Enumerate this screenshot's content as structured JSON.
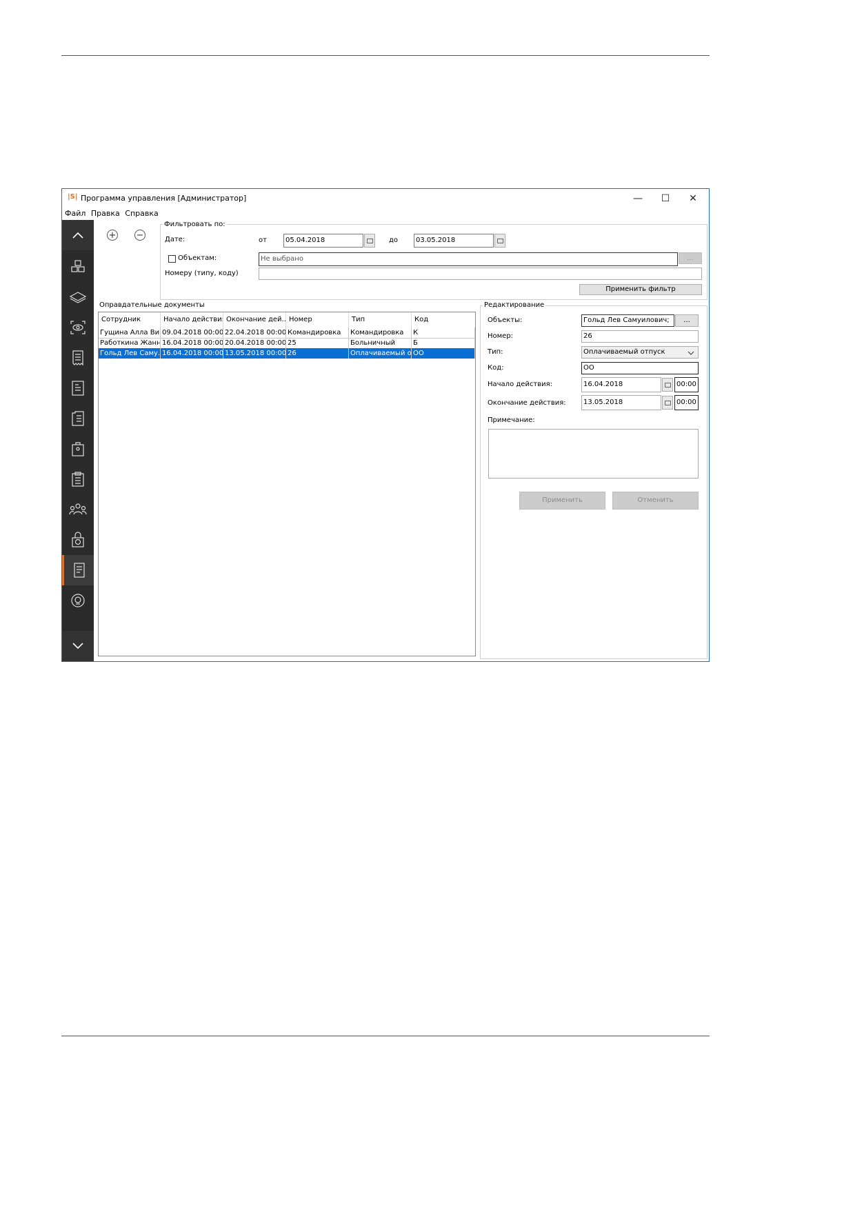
{
  "window": {
    "logo": "|S|",
    "title": "Программа управления [Администратор]",
    "minimize": "—",
    "maximize": "☐",
    "close": "✕"
  },
  "menu": [
    "Файл",
    "Правка",
    "Справка"
  ],
  "toolbar": {
    "add": "+",
    "remove": "−"
  },
  "filter": {
    "group_title": "Фильтровать по:",
    "date_label": "Дате:",
    "from_label": "от",
    "from_value": "05.04.2018",
    "to_label": "до",
    "to_value": "03.05.2018",
    "objects_label": "Объектам:",
    "objects_value": "Не выбрано",
    "objects_browse": "...",
    "number_label": "Номеру (типу, коду)",
    "number_value": "",
    "apply_button": "Применить фильтр"
  },
  "documents": {
    "group_title": "Оправдательные документы",
    "columns": [
      "Сотрудник",
      "Начало действия",
      "Окончание дей...",
      "Номер",
      "Тип",
      "Код"
    ],
    "rows": [
      [
        "Гущина Алла Ви...",
        "09.04.2018 00:00",
        "22.04.2018 00:00",
        "Командировка",
        "Командировка",
        "К"
      ],
      [
        "Работкина Жанн...",
        "16.04.2018 00:00",
        "20.04.2018 00:00",
        "25",
        "Больничный",
        "Б"
      ],
      [
        "Гольд Лев Саму...",
        "16.04.2018 00:00",
        "13.05.2018 00:00",
        "26",
        "Оплачиваемый о...",
        "ОО"
      ]
    ],
    "selected_row": 2
  },
  "edit": {
    "group_title": "Редактирование",
    "objects_label": "Объекты:",
    "objects_value": "Гольд Лев Самуилович;",
    "objects_browse": "...",
    "number_label": "Номер:",
    "number_value": "26",
    "type_label": "Тип:",
    "type_value": "Оплачиваемый отпуск",
    "code_label": "Код:",
    "code_value": "ОО",
    "start_label": "Начало действия:",
    "start_date": "16.04.2018",
    "start_time": "00:00",
    "end_label": "Окончание действия:",
    "end_date": "13.05.2018",
    "end_time": "00:00",
    "note_label": "Примечание:",
    "note_value": "",
    "apply_button": "Применить",
    "cancel_button": "Отменить"
  },
  "sidebar": {
    "items": [
      "chevron-up-icon",
      "cubes-icon",
      "layers-icon",
      "scan-eye-icon",
      "receipt-icon",
      "document-text-icon",
      "document-list-icon",
      "shopping-bag-icon",
      "clipboard-icon",
      "people-icon",
      "lock-check-icon",
      "justification-document-icon",
      "support-icon",
      "chevron-down-icon"
    ],
    "active_index": 11
  },
  "colors": {
    "accent": "#e0702a",
    "selection": "#0a6fd4",
    "sidebar": "#2b2b2b",
    "window_border": "#1a73c6"
  }
}
